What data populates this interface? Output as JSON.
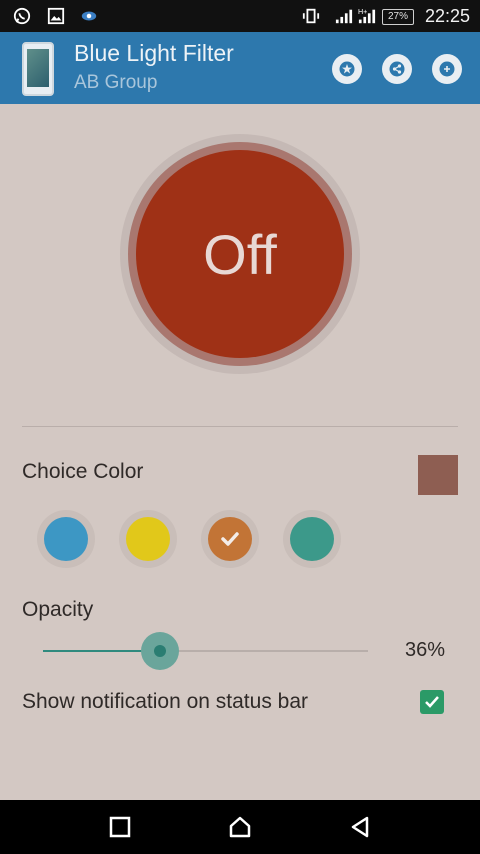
{
  "status_bar": {
    "time": "22:25",
    "battery": "27%",
    "icons": [
      "whatsapp-icon",
      "gallery-icon",
      "eye-icon",
      "vibrate-icon",
      "signal-icon",
      "hplus-signal-icon",
      "battery-icon"
    ]
  },
  "app_bar": {
    "title": "Blue Light Filter",
    "subtitle": "AB Group",
    "actions": [
      "star-icon",
      "share-icon",
      "plus-icon"
    ]
  },
  "power_button": {
    "label": "Off"
  },
  "choice_color": {
    "label": "Choice Color",
    "selected_color": "#8e5e52",
    "swatches": [
      {
        "color": "#3d97c4",
        "selected": false
      },
      {
        "color": "#e1c81a",
        "selected": false
      },
      {
        "color": "#c27436",
        "selected": true
      },
      {
        "color": "#3c998a",
        "selected": false
      }
    ]
  },
  "opacity": {
    "label": "Opacity",
    "value_text": "36%",
    "value": 0.36
  },
  "notification": {
    "label": "Show notification on status bar",
    "checked": true
  },
  "nav_bar": {
    "buttons": [
      "recents-icon",
      "home-icon",
      "back-icon"
    ]
  },
  "colors": {
    "app_bar": "#2d78ad",
    "background": "#d3c8c3",
    "power_off": "#9f3116",
    "accent": "#2f8a7e"
  }
}
